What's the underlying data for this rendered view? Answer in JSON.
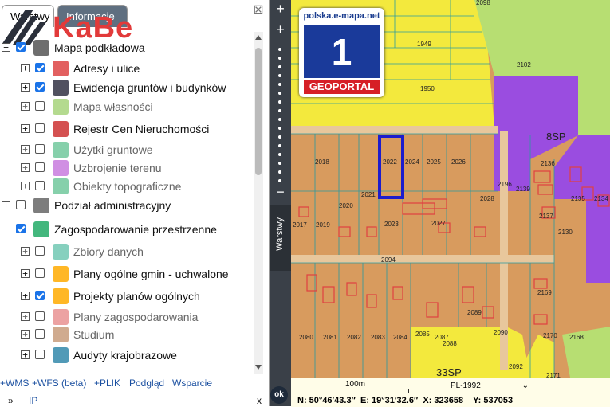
{
  "tabs": {
    "active": "Warstwy",
    "inactive": "Informacje"
  },
  "logo": {
    "text": "KaBe"
  },
  "layers": [
    {
      "label": "Mapa podkładowa",
      "checked": true,
      "grey": false
    },
    {
      "label": "Adresy i ulice",
      "checked": true,
      "grey": false
    },
    {
      "label": "Ewidencja gruntów i budynków",
      "checked": true,
      "grey": false
    },
    {
      "label": "Mapa własności",
      "checked": false,
      "grey": true
    },
    {
      "label": "Rejestr Cen Nieruchomości",
      "checked": false,
      "grey": false
    },
    {
      "label": "Użytki gruntowe",
      "checked": false,
      "grey": true
    },
    {
      "label": "Uzbrojenie terenu",
      "checked": false,
      "grey": true
    },
    {
      "label": "Obiekty topograficzne",
      "checked": false,
      "grey": true
    },
    {
      "label": "Podział administracyjny",
      "checked": false,
      "grey": false
    },
    {
      "label": "Zagospodarowanie przestrzenne",
      "checked": true,
      "grey": false
    },
    {
      "label": "Zbiory danych",
      "checked": false,
      "grey": true
    },
    {
      "label": "Plany ogólne gmin - uchwalone",
      "checked": false,
      "grey": false
    },
    {
      "label": "Projekty planów ogólnych",
      "checked": true,
      "grey": false
    },
    {
      "label": "Plany zagospodarowania",
      "checked": false,
      "grey": true
    },
    {
      "label": "Studium",
      "checked": false,
      "grey": true
    },
    {
      "label": "Audyty krajobrazowe",
      "checked": false,
      "grey": false
    }
  ],
  "bottom_links": {
    "wms": "+WMS",
    "wfs": "+WFS (beta)",
    "plik": "+PLIK",
    "podglad": "Podgląd",
    "wsparcie": "Wsparcie",
    "ip": "IP",
    "more": "»",
    "close": "x"
  },
  "toolbar": {
    "zoom_in": "+",
    "zoom_out": "−",
    "layers_tab": "Warstwy"
  },
  "badge": {
    "url": "polska.e-mapa.net",
    "number": "1",
    "label": "GEOPORTAL"
  },
  "map_labels": [
    "2098",
    "1949",
    "2102",
    "1950",
    "8SP",
    "2018",
    "2022",
    "2024",
    "2025",
    "2026",
    "2196",
    "2139",
    "2136",
    "2135",
    "2134",
    "2021",
    "2020",
    "2017",
    "2019",
    "2023",
    "2027",
    "2028",
    "2137",
    "2130",
    "2094",
    "2169",
    "2089",
    "2080",
    "2081",
    "2082",
    "2083",
    "2084",
    "2085",
    "2087",
    "2088",
    "2090",
    "2170",
    "2168",
    "2092",
    "2171",
    "33SP"
  ],
  "status": {
    "ok": "ok",
    "scale": "100m",
    "crs": "PL-1992",
    "n": "N: 50°46′43.3″",
    "e": "E: 19°31′32.6″",
    "x": "X: 323658",
    "y": "Y: 537053"
  },
  "colors": {
    "parcel": "#d89b5e",
    "yellow": "#f3e93d",
    "green": "#b7de72",
    "purple": "#9a4de0",
    "highlight": "#1c1ccc",
    "building": "#e04040"
  }
}
